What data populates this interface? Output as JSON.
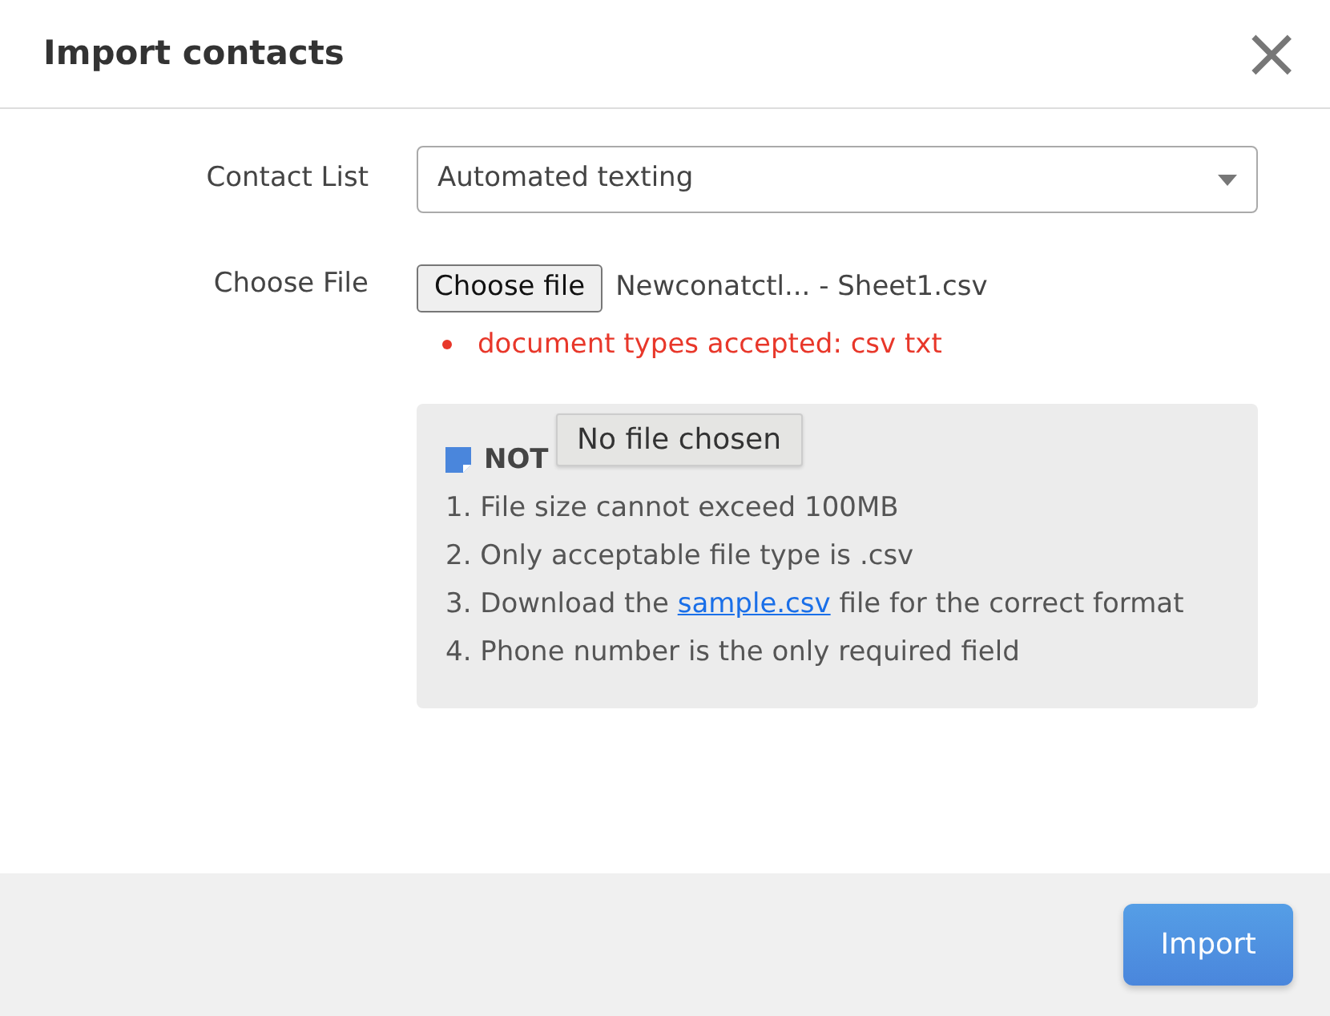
{
  "dialog": {
    "title": "Import contacts",
    "close": "×"
  },
  "contact_list": {
    "label": "Contact List",
    "value": "Automated texting"
  },
  "choose_file": {
    "label": "Choose File",
    "button": "Choose file",
    "file_name": "Newconatctl... - Sheet1.csv",
    "errors": [
      "document types accepted: csv txt"
    ],
    "tooltip": "No file chosen"
  },
  "note": {
    "heading": "NOT",
    "items": [
      {
        "kind": "text",
        "text": "1. File size cannot exceed 100MB"
      },
      {
        "kind": "text",
        "text": "2. Only acceptable file type is .csv"
      },
      {
        "kind": "link",
        "before": "3. Download the ",
        "link": "sample.csv",
        "after": " file for the correct format"
      },
      {
        "kind": "text",
        "text": "4. Phone number is the only required field"
      }
    ]
  },
  "footer": {
    "buttons": [
      "Import"
    ]
  }
}
